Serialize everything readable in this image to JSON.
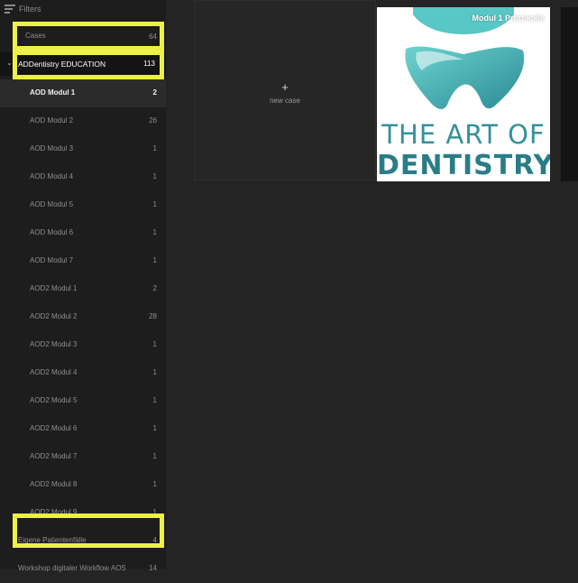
{
  "filters": {
    "label": "Filters",
    "icon": "filter-lines-icon"
  },
  "cases": {
    "label": "Cases",
    "count": "64"
  },
  "group": {
    "label": "ADDentistry EDUCATION",
    "count": "113",
    "icon": "caret-down-icon"
  },
  "modules": [
    {
      "label": "AOD Modul 1",
      "count": "2"
    },
    {
      "label": "AOD Modul 2",
      "count": "26"
    },
    {
      "label": "AOD Modul 3",
      "count": "1"
    },
    {
      "label": "AOD Modul 4",
      "count": "1"
    },
    {
      "label": "AOD Modul 5",
      "count": "1"
    },
    {
      "label": "AOD Modul 6",
      "count": "1"
    },
    {
      "label": "AOD Modul 7",
      "count": "1"
    },
    {
      "label": "AOD2 Modul 1",
      "count": "2"
    },
    {
      "label": "AOD2 Modul 2",
      "count": "28"
    },
    {
      "label": "AOD2 Modul 3",
      "count": "1"
    },
    {
      "label": "AOD2 Modul 4",
      "count": "1"
    },
    {
      "label": "AOD2 Modul 5",
      "count": "1"
    },
    {
      "label": "AOD2 Modul 6",
      "count": "1"
    },
    {
      "label": "AOD2 Modul 7",
      "count": "1"
    },
    {
      "label": "AOD2 Modul 8",
      "count": "1"
    },
    {
      "label": "AOD2 Modul 9",
      "count": "1"
    },
    {
      "label": "Eigene Patientenfälle",
      "count": "4"
    },
    {
      "label": "Workshop digitaler Workflow AOS",
      "count": "14"
    }
  ],
  "new_case": {
    "icon_text": "+",
    "label": "new case"
  },
  "logo_card": {
    "badge": "Modul 1 Protokolle",
    "line1": "THE ART OF",
    "line2": "DENTISTRY",
    "colors": {
      "tooth_light": "#56c6c6",
      "tooth_dark": "#2b8b94",
      "text": "#35909a"
    }
  },
  "highlight_color": "#eef145"
}
